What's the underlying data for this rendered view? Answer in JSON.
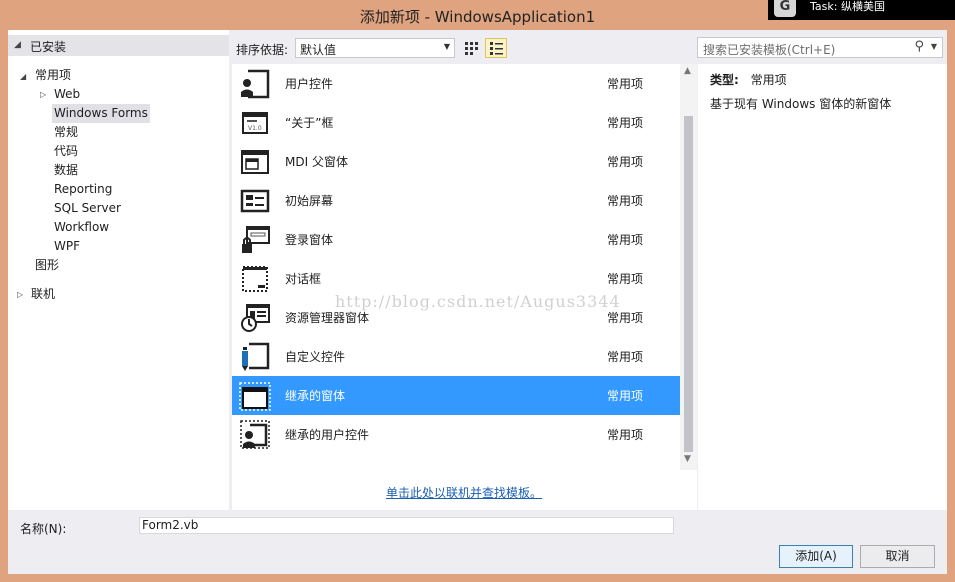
{
  "window": {
    "title": "添加新项 - WindowsApplication1"
  },
  "task_badge": {
    "logo": "G",
    "text": "Task:  纵横美国"
  },
  "left_tree": {
    "header": "已安装",
    "items": [
      {
        "label": "常用项",
        "expander": "expanded"
      },
      {
        "label": "Web",
        "expander": "collapsed"
      },
      {
        "label": "Windows Forms",
        "selected": true
      },
      {
        "label": "常规"
      },
      {
        "label": "代码"
      },
      {
        "label": "数据"
      },
      {
        "label": "Reporting"
      },
      {
        "label": "SQL Server"
      },
      {
        "label": "Workflow"
      },
      {
        "label": "WPF"
      },
      {
        "label": "图形"
      },
      {
        "label": "联机",
        "expander": "collapsed"
      }
    ]
  },
  "toolbar": {
    "sort_label": "排序依据:",
    "sort_value": "默认值",
    "view_small_icons": "small-icons-view-icon",
    "view_list": "list-view-icon",
    "search_placeholder": "搜索已安装模板(Ctrl+E)"
  },
  "templates": [
    {
      "name": "用户控件",
      "category": "常用项",
      "icon": "user-control-icon"
    },
    {
      "name": "“关于”框",
      "category": "常用项",
      "icon": "about-box-icon"
    },
    {
      "name": "MDI 父窗体",
      "category": "常用项",
      "icon": "mdi-parent-form-icon"
    },
    {
      "name": "初始屏幕",
      "category": "常用项",
      "icon": "splash-screen-icon"
    },
    {
      "name": "登录窗体",
      "category": "常用项",
      "icon": "login-form-icon"
    },
    {
      "name": "对话框",
      "category": "常用项",
      "icon": "dialog-icon"
    },
    {
      "name": "资源管理器窗体",
      "category": "常用项",
      "icon": "explorer-form-icon"
    },
    {
      "name": "自定义控件",
      "category": "常用项",
      "icon": "custom-control-icon"
    },
    {
      "name": "继承的窗体",
      "category": "常用项",
      "icon": "inherited-form-icon",
      "selected": true
    },
    {
      "name": "继承的用户控件",
      "category": "常用项",
      "icon": "inherited-user-control-icon"
    }
  ],
  "online_link": "单击此处以联机并查找模板。",
  "info": {
    "type_label": "类型:",
    "type_value": "常用项",
    "description": "基于现有 Windows 窗体的新窗体"
  },
  "name_row": {
    "label": "名称(N):",
    "value": "Form2.vb"
  },
  "buttons": {
    "add": "添加(A)",
    "cancel": "取消"
  },
  "watermark": "http://blog.csdn.net/Augus3344",
  "colors": {
    "title_bar": "#dfa37f",
    "selection": "#3399ff",
    "client_bg": "#eeeef2"
  }
}
